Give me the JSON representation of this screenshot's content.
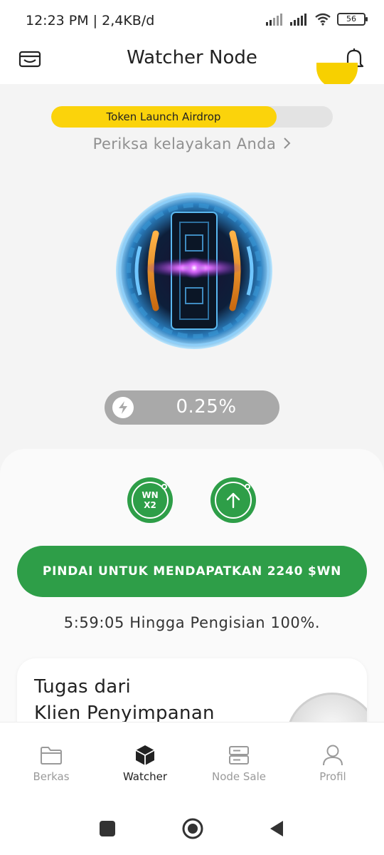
{
  "status_bar": {
    "time": "12:23 PM | 2,4KB/d",
    "battery": "56"
  },
  "header": {
    "title": "Watcher Node",
    "left_icon": "wallet-icon",
    "right_icon": "bell-icon"
  },
  "airdrop": {
    "label": "Token Launch Airdrop",
    "progress": 0.8,
    "eligibility_text": "Periksa kelayakan Anda",
    "eligibility_icon": "chevron-right-icon"
  },
  "charge": {
    "icon": "lightning-icon",
    "value": "0.25%"
  },
  "boosts": {
    "x2_line1": "WN",
    "x2_line2": "X2",
    "upgrade_icon": "arrow-up-icon"
  },
  "scan_button": {
    "label": "PINDAI UNTUK MENDAPATKAN 2240 $WN"
  },
  "countdown": {
    "text": "5:59:05 Hingga Pengisian 100%."
  },
  "task_card": {
    "title_line1": "Tugas dari",
    "title_line2": "Klien Penyimpanan"
  },
  "bottom_nav": {
    "items": [
      {
        "label": "Berkas",
        "icon": "folder-icon",
        "active": false
      },
      {
        "label": "Watcher",
        "icon": "cube-icon",
        "active": true
      },
      {
        "label": "Node Sale",
        "icon": "server-icon",
        "active": false
      },
      {
        "label": "Profil",
        "icon": "person-icon",
        "active": false
      }
    ]
  },
  "colors": {
    "accent_green": "#2e9e48",
    "airdrop_yellow": "#fbd30b",
    "charge_gray": "#a9a9a9"
  }
}
